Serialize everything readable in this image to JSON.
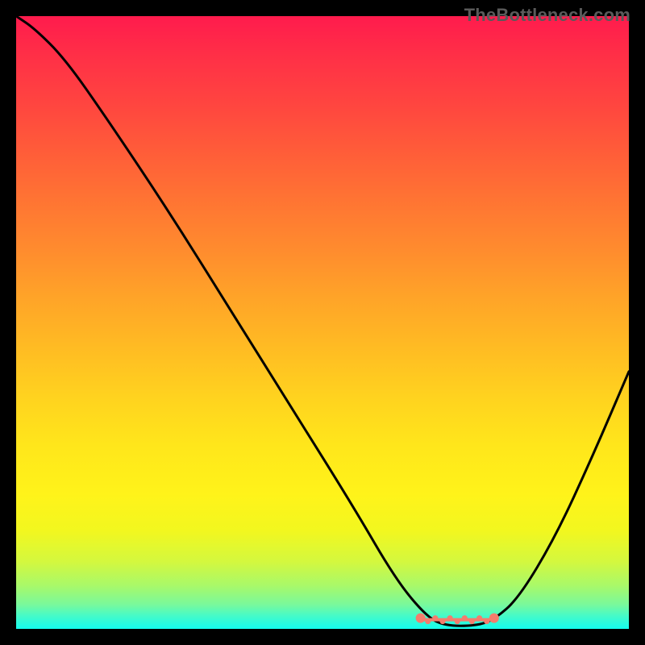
{
  "watermark": "TheBottleneck.com",
  "chart_data": {
    "type": "line",
    "title": "",
    "xlabel": "",
    "ylabel": "",
    "x_range": [
      0,
      100
    ],
    "y_range": [
      0,
      100
    ],
    "curve_points": [
      {
        "x": 0,
        "y": 100
      },
      {
        "x": 3,
        "y": 98
      },
      {
        "x": 8,
        "y": 93
      },
      {
        "x": 15,
        "y": 83
      },
      {
        "x": 25,
        "y": 68
      },
      {
        "x": 35,
        "y": 52
      },
      {
        "x": 45,
        "y": 36
      },
      {
        "x": 55,
        "y": 20
      },
      {
        "x": 62,
        "y": 8
      },
      {
        "x": 67,
        "y": 2
      },
      {
        "x": 70,
        "y": 0.5
      },
      {
        "x": 75,
        "y": 0.5
      },
      {
        "x": 78,
        "y": 1.5
      },
      {
        "x": 82,
        "y": 5
      },
      {
        "x": 88,
        "y": 15
      },
      {
        "x": 94,
        "y": 28
      },
      {
        "x": 100,
        "y": 42
      }
    ],
    "marker_band": {
      "x_start": 66,
      "x_end": 78,
      "y": 1.5,
      "color": "#f47c6d"
    },
    "gradient_stops": [
      {
        "pos": 0,
        "color": "#ff1b4d"
      },
      {
        "pos": 50,
        "color": "#ffbb23"
      },
      {
        "pos": 80,
        "color": "#fff31a"
      },
      {
        "pos": 100,
        "color": "#14fbee"
      }
    ]
  }
}
